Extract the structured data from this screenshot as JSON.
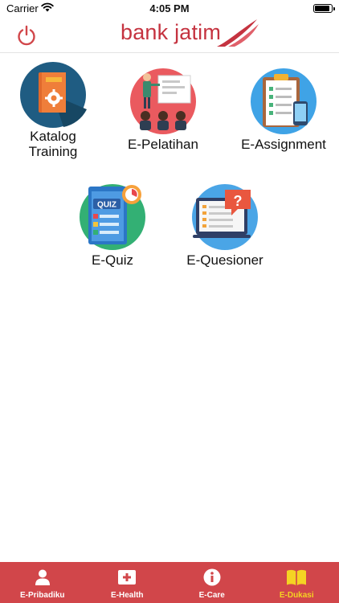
{
  "status_bar": {
    "carrier": "Carrier",
    "time": "4:05 PM"
  },
  "header": {
    "logo_text_bank": "bank",
    "logo_text_jatim": "jatim",
    "brand_color": "#c53340"
  },
  "menu": [
    {
      "label": "Katalog\nTraining",
      "icon": "catalog-book-icon"
    },
    {
      "label": "E-Pelatihan",
      "icon": "presentation-icon"
    },
    {
      "label": "E-Assignment",
      "icon": "clipboard-checklist-icon"
    },
    {
      "label": "E-Quiz",
      "icon": "quiz-icon"
    },
    {
      "label": "E-Quesioner",
      "icon": "questionnaire-icon"
    }
  ],
  "bottom_nav": {
    "background": "#d1464a",
    "active_color": "#f5d323",
    "items": [
      {
        "label": "E-Pribadiku",
        "icon": "person-icon",
        "active": false
      },
      {
        "label": "E-Health",
        "icon": "health-plus-icon",
        "active": false
      },
      {
        "label": "E-Care",
        "icon": "info-icon",
        "active": false
      },
      {
        "label": "E-Dukasi",
        "icon": "book-icon",
        "active": true
      }
    ]
  }
}
